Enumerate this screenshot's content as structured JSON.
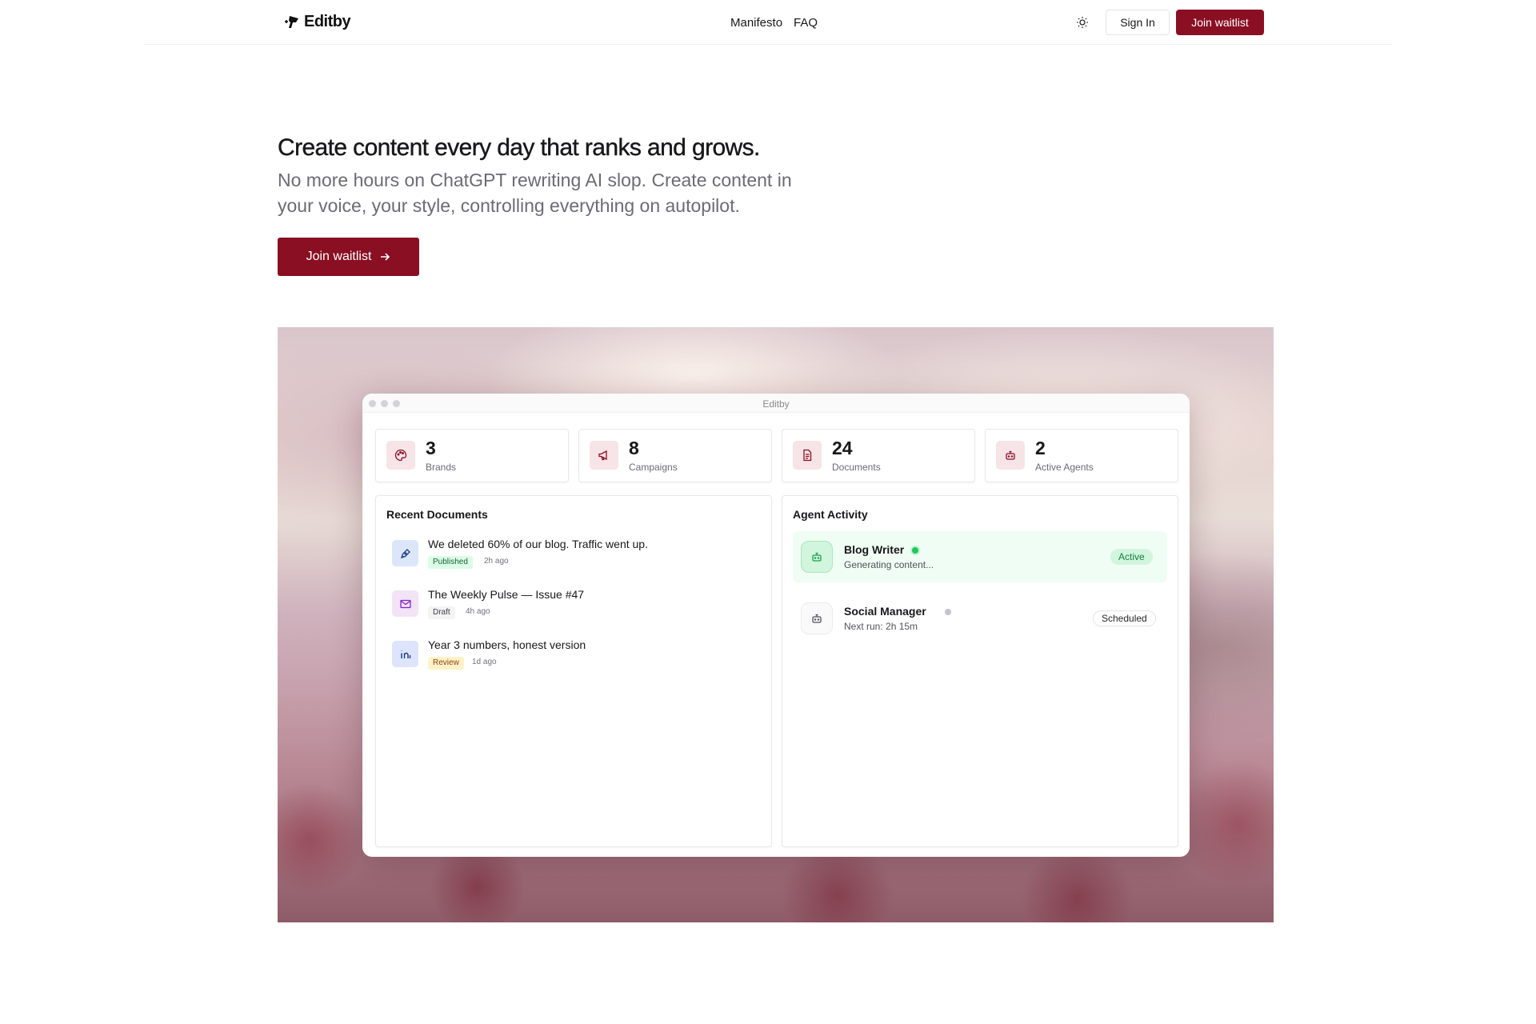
{
  "nav": {
    "brand": "Editby",
    "links": [
      "Manifesto",
      "FAQ"
    ],
    "sign_in": "Sign In",
    "join": "Join waitlist"
  },
  "hero": {
    "title": "Create content every day that ranks and grows.",
    "subtitle": "No more hours on ChatGPT rewriting AI slop. Create content in your voice, your style, controlling everything on autopilot.",
    "cta": "Join waitlist"
  },
  "app": {
    "window_title": "Editby",
    "stats": [
      {
        "value": "3",
        "label": "Brands",
        "icon": "palette-icon"
      },
      {
        "value": "8",
        "label": "Campaigns",
        "icon": "megaphone-icon"
      },
      {
        "value": "24",
        "label": "Documents",
        "icon": "document-icon"
      },
      {
        "value": "2",
        "label": "Active Agents",
        "icon": "bot-icon"
      }
    ],
    "recent_documents": {
      "title": "Recent Documents",
      "items": [
        {
          "title": "We deleted 60% of our blog. Traffic went up.",
          "status": "Published",
          "time": "2h ago",
          "icon": "pen-icon"
        },
        {
          "title": "The Weekly Pulse — Issue #47",
          "status": "Draft",
          "time": "4h ago",
          "icon": "mail-icon"
        },
        {
          "title": "Year 3 numbers, honest version",
          "status": "Review",
          "time": "1d ago",
          "icon": "linkedin-icon"
        }
      ]
    },
    "agent_activity": {
      "title": "Agent Activity",
      "agents": [
        {
          "name": "Blog Writer",
          "status": "Generating content...",
          "badge": "Active"
        },
        {
          "name": "Social Manager",
          "status": "Next run: 2h 15m",
          "badge": "Scheduled"
        }
      ]
    }
  },
  "colors": {
    "accent": "#8a0f23",
    "published_bg": "#dcfce7",
    "draft_bg": "#f4f4f5",
    "review_bg": "#fef3c7",
    "active_green": "#22c55e"
  }
}
